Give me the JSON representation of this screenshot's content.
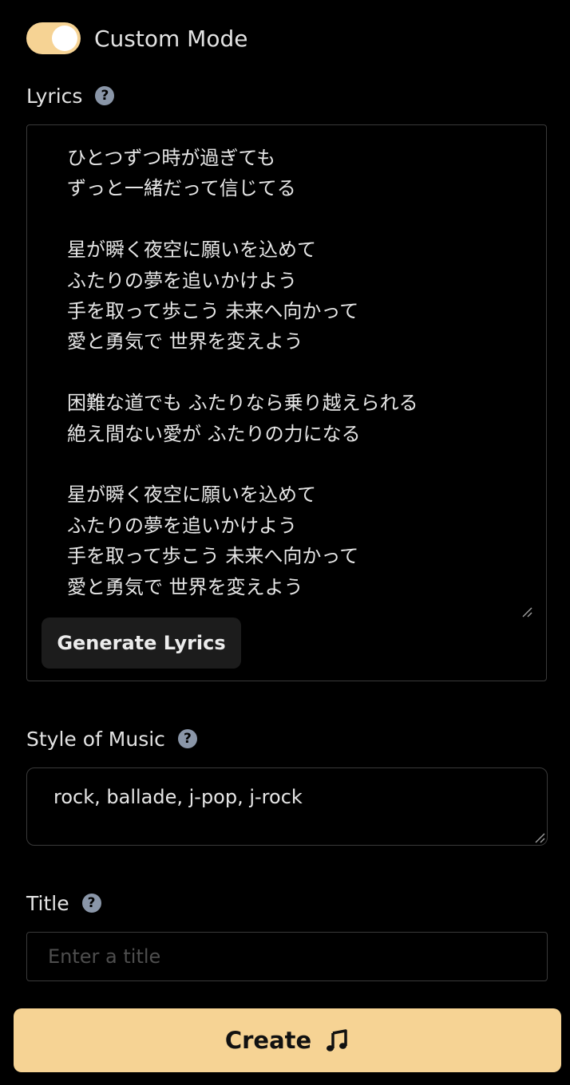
{
  "custom_mode": {
    "label": "Custom Mode",
    "enabled": true,
    "color": "#f6d394"
  },
  "lyrics": {
    "label": "Lyrics",
    "help_icon": "question-circle-icon",
    "value": "ひとつずつ時が過ぎても\nずっと一緒だって信じてる\n\n星が瞬く夜空に願いを込めて\nふたりの夢を追いかけよう\n手を取って歩こう 未来へ向かって\n愛と勇気で 世界を変えよう\n\n困難な道でも ふたりなら乗り越えられる\n絶え間ない愛が ふたりの力になる\n\n星が瞬く夜空に願いを込めて\nふたりの夢を追いかけよう\n手を取って歩こう 未来へ向かって\n愛と勇気で 世界を変えよう",
    "generate_button": "Generate Lyrics"
  },
  "style": {
    "label": "Style of Music",
    "help_icon": "question-circle-icon",
    "value": "rock, ballade, j-pop, j-rock"
  },
  "title": {
    "label": "Title",
    "help_icon": "question-circle-icon",
    "placeholder": "Enter a title",
    "value": ""
  },
  "create": {
    "label": "Create",
    "icon": "music-note-icon",
    "color": "#f6d394"
  }
}
